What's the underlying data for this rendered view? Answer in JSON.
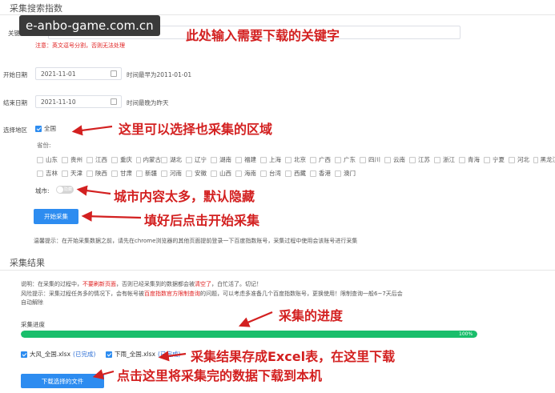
{
  "watermark": "e-anbo-game.com.cn",
  "search": {
    "section_title": "采集搜索指数",
    "keyword_label": "关键字",
    "keyword_note": "注意：英文逗号分割，否则无法处理",
    "start_label": "开始日期",
    "start_value": "2021-11-01",
    "start_hint": "时间最早为2011-01-01",
    "end_label": "结束日期",
    "end_value": "2021-11-10",
    "end_hint": "时间最晚为昨天",
    "region_label": "选择地区",
    "nationwide_label": "全国",
    "province_label": "省份:",
    "provinces": [
      "山东",
      "贵州",
      "江西",
      "重庆",
      "内蒙古",
      "湖北",
      "辽宁",
      "湖南",
      "福建",
      "上海",
      "北京",
      "广西",
      "广东",
      "四川",
      "云南",
      "江苏",
      "浙江",
      "青海",
      "宁夏",
      "河北",
      "黑龙江",
      "吉林",
      "天津",
      "陕西",
      "甘肃",
      "新疆",
      "河南",
      "安徽",
      "山西",
      "海南",
      "台湾",
      "西藏",
      "香港",
      "澳门"
    ],
    "city_label": "城市:",
    "city_toggle_text": "隐藏",
    "start_button": "开始采集",
    "tip": "温馨提示：在开始采集数据之前，请先在chrome浏览器的其他页面提前登录一下百度指数账号，采集过程中使用会该账号进行采集"
  },
  "results": {
    "section_title": "采集结果",
    "notice_1_prefix": "说明：在采集的过程中，",
    "notice_1_red": "不要刷新页面",
    "notice_1_mid": "，否则已经采集到的数据都会被",
    "notice_1_red2": "清空了",
    "notice_1_suffix": "，白忙活了。切记！",
    "notice_2_prefix": "风险提示：采集过程任务多的情况下，会有帐号被",
    "notice_2_red": "百度指数官方限制查询",
    "notice_2_suffix": "的问题，可以考虑多准备几个百度指数账号，更换使用！限制查询一般6~7天后会",
    "notice_3": "自动解除",
    "progress_label": "采集进度",
    "progress_text": "100%",
    "progress_percent": 100,
    "files": [
      {
        "name": "大风_全国.xlsx",
        "status": "(已完成)"
      },
      {
        "name": "下雨_全国.xlsx",
        "status": "(已完成)"
      }
    ],
    "download_button": "下载选择的文件"
  },
  "annotations": {
    "keyword": "此处输入需要下载的关键字",
    "region": "这里可以选择也采集的区域",
    "city": "城市内容太多，默认隐藏",
    "start": "填好后点击开始采集",
    "progress": "采集的进度",
    "excel": "采集结果存成Excel表，在这里下载",
    "download": "点击这里将采集完的数据下载到本机"
  },
  "colors": {
    "primary": "#2d8cf0",
    "progress": "#19be6b",
    "annotation": "#d32020"
  }
}
